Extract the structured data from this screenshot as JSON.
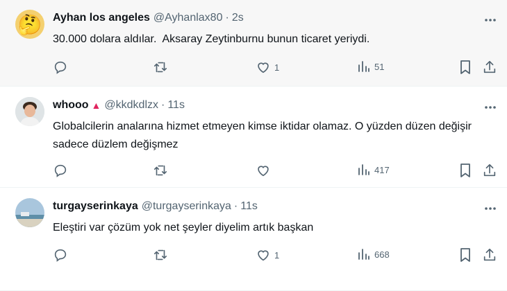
{
  "tweets": [
    {
      "name": "Ayhan los angeles",
      "handle": "@Ayhanlax80",
      "dot": "·",
      "time": "2s",
      "text": "30.000 dolara aldılar.  Aksaray Zeytinburnu bunun ticaret yeriydi.",
      "likes": "1",
      "views": "51",
      "avatar_emoji": "🤔"
    },
    {
      "name": "whooo",
      "badge": "▲",
      "handle": "@kkdkdlzx",
      "dot": "·",
      "time": "11s",
      "text": "Globalcilerin analarına hizmet etmeyen kimse iktidar olamaz. O yüzden düzen değişir sadece düzlem değişmez",
      "likes": "",
      "views": "417"
    },
    {
      "name": "turgayserinkaya",
      "handle": "@turgayserinkaya",
      "dot": "·",
      "time": "11s",
      "text": "Eleştiri var çözüm yok net şeyler diyelim artık başkan",
      "likes": "1",
      "views": "668"
    }
  ],
  "colors": {
    "muted": "#536471",
    "text": "#0f1419",
    "badge": "#e0245e",
    "highlight_bg": "#f7f7f7"
  },
  "icons": [
    "reply-icon",
    "retweet-icon",
    "like-icon",
    "views-icon",
    "bookmark-icon",
    "share-icon",
    "more-icon"
  ]
}
